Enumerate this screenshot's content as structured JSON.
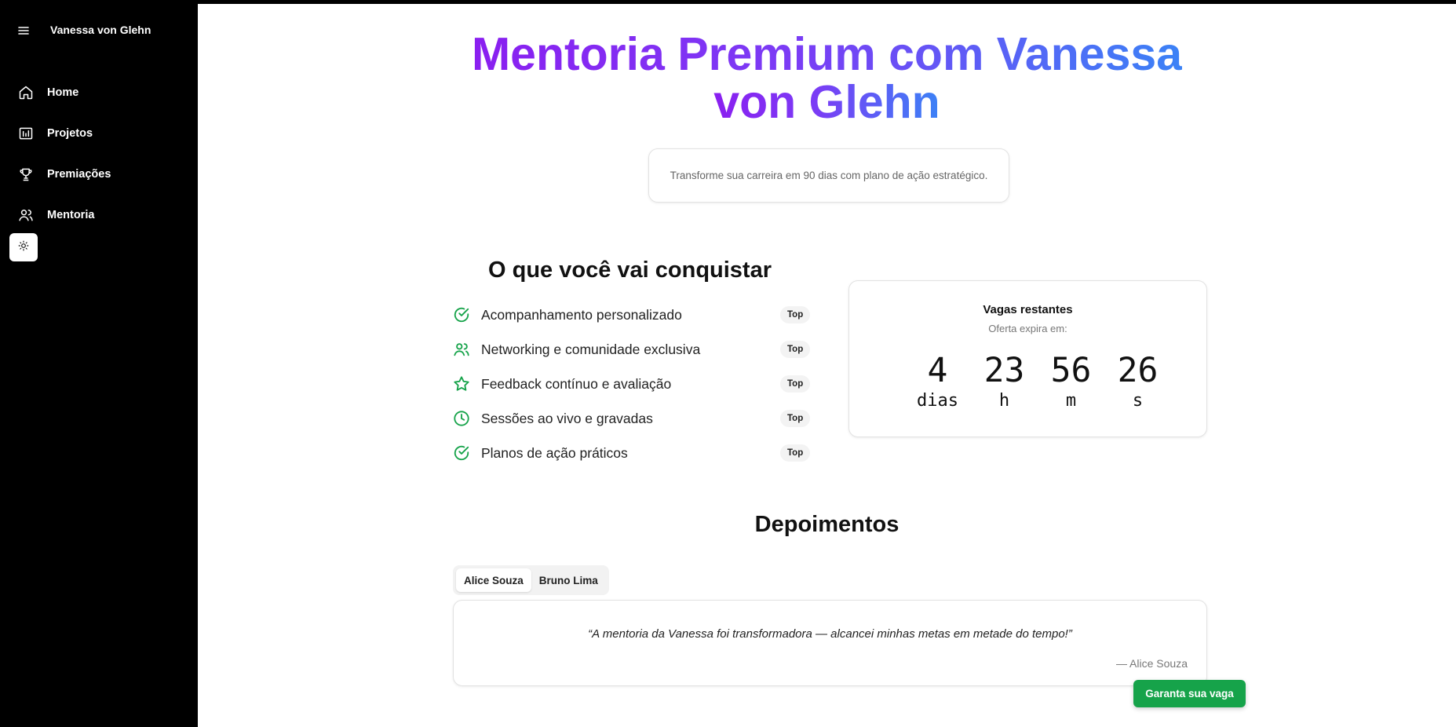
{
  "sidebar": {
    "title": "Vanessa von Glehn",
    "items": [
      {
        "label": "Home",
        "icon": "home-icon"
      },
      {
        "label": "Projetos",
        "icon": "projects-chart-icon"
      },
      {
        "label": "Premiações",
        "icon": "trophy-icon"
      },
      {
        "label": "Mentoria",
        "icon": "users-icon"
      }
    ],
    "theme_icon": "sun-icon"
  },
  "hero": {
    "title_line1": "Mentoria Premium com Vanessa",
    "title_line2": "von Glehn",
    "subtitle": "Transforme sua carreira em 90 dias com plano de ação estratégico."
  },
  "benefits": {
    "title": "O que você vai conquistar",
    "items": [
      {
        "text": "Acompanhamento personalizado",
        "badge": "Top",
        "icon": "check-circle-icon"
      },
      {
        "text": "Networking e comunidade exclusiva",
        "badge": "Top",
        "icon": "users-icon"
      },
      {
        "text": "Feedback contínuo e avaliação",
        "badge": "Top",
        "icon": "star-icon"
      },
      {
        "text": "Sessões ao vivo e gravadas",
        "badge": "Top",
        "icon": "clock-icon"
      },
      {
        "text": "Planos de ação práticos",
        "badge": "Top",
        "icon": "check-circle-icon"
      }
    ]
  },
  "timer": {
    "title": "Vagas restantes",
    "subtitle": "Oferta expira em:",
    "units": [
      {
        "value": "4",
        "label": "dias"
      },
      {
        "value": "23",
        "label": "h"
      },
      {
        "value": "56",
        "label": "m"
      },
      {
        "value": "26",
        "label": "s"
      }
    ]
  },
  "testimonials": {
    "title": "Depoimentos",
    "tabs": [
      "Alice Souza",
      "Bruno Lima"
    ],
    "active_tab": "Alice Souza",
    "quote": "“A mentoria da Vanessa foi transformadora — alcancei minhas metas em metade do tempo!”",
    "author": "— Alice Souza"
  },
  "cta": {
    "label": "Garanta sua vaga"
  },
  "colors": {
    "accent_green": "#16a34a",
    "gradient_start": "#8a1ff0",
    "gradient_end": "#3b82f6"
  }
}
